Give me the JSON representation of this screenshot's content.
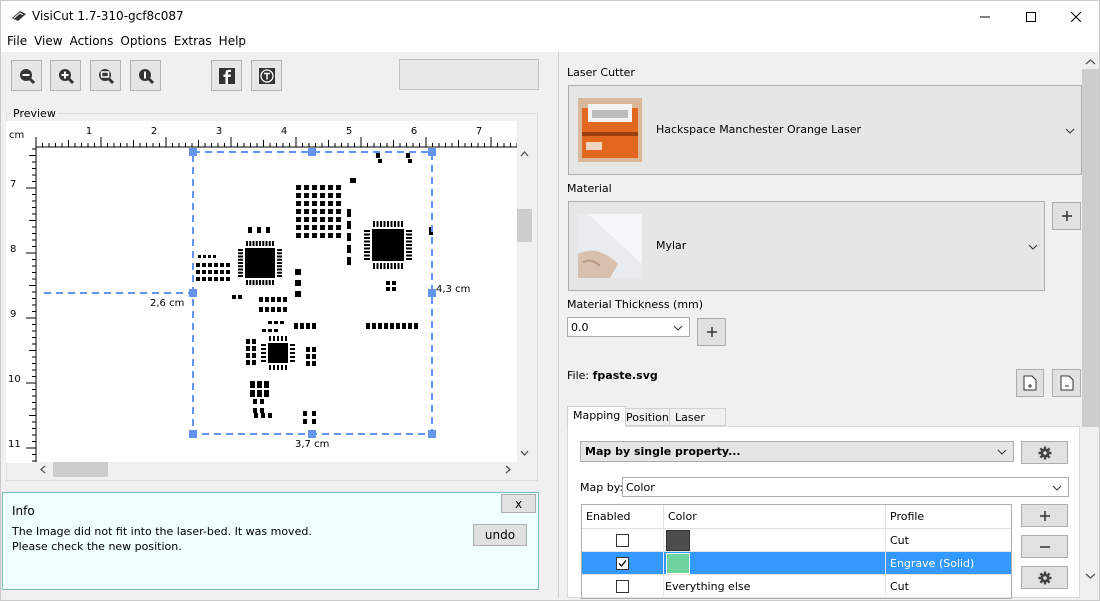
{
  "window": {
    "title": "VisiCut 1.7-310-gcf8c087"
  },
  "menu": [
    "File",
    "View",
    "Actions",
    "Options",
    "Extras",
    "Help"
  ],
  "toolbar": {
    "icons": [
      "zoom-out-icon",
      "zoom-in-icon",
      "zoom-fit-icon",
      "zoom-actual-icon",
      "facebook-icon",
      "thingiverse-icon"
    ]
  },
  "preview": {
    "title": "Preview",
    "unit": "cm",
    "ruler_x": [
      "1",
      "2",
      "3",
      "4",
      "5",
      "6",
      "7"
    ],
    "ruler_y": [
      "7",
      "8",
      "9",
      "10",
      "11"
    ],
    "dim_left": "2,6 cm",
    "dim_right": "4,3 cm",
    "dim_bottom": "3,7 cm"
  },
  "info": {
    "title": "Info",
    "line1": "The Image did not fit into the laser-bed. It was moved.",
    "line2": "Please check the new position.",
    "close_label": "x",
    "undo_label": "undo"
  },
  "right": {
    "laser_cutter_label": "Laser Cutter",
    "laser_cutter_value": "Hackspace Manchester Orange Laser",
    "material_label": "Material",
    "material_value": "Mylar",
    "thickness_label": "Material Thickness (mm)",
    "thickness_value": "0.0",
    "file_prefix": "File:",
    "file_name": "fpaste.svg",
    "tabs": [
      "Mapping",
      "Position",
      "Laser Settings"
    ],
    "mapping_value": "Map by single property...",
    "mapby_label": "Map by:",
    "mapby_value": "Color",
    "table": {
      "headers": [
        "Enabled",
        "Color",
        "Profile"
      ],
      "rows": [
        {
          "enabled": false,
          "color": "#4d4d4d",
          "color_text": "",
          "profile": "Cut"
        },
        {
          "enabled": true,
          "color": "#6fd3a0",
          "color_text": "",
          "profile": "Engrave (Solid)"
        },
        {
          "enabled": false,
          "color": "",
          "color_text": "Everything else",
          "profile": "Cut"
        }
      ]
    }
  },
  "colors": {
    "accent": "#3399ff",
    "selection_dash": "#6495ed",
    "info_bg": "#f0ffff"
  }
}
